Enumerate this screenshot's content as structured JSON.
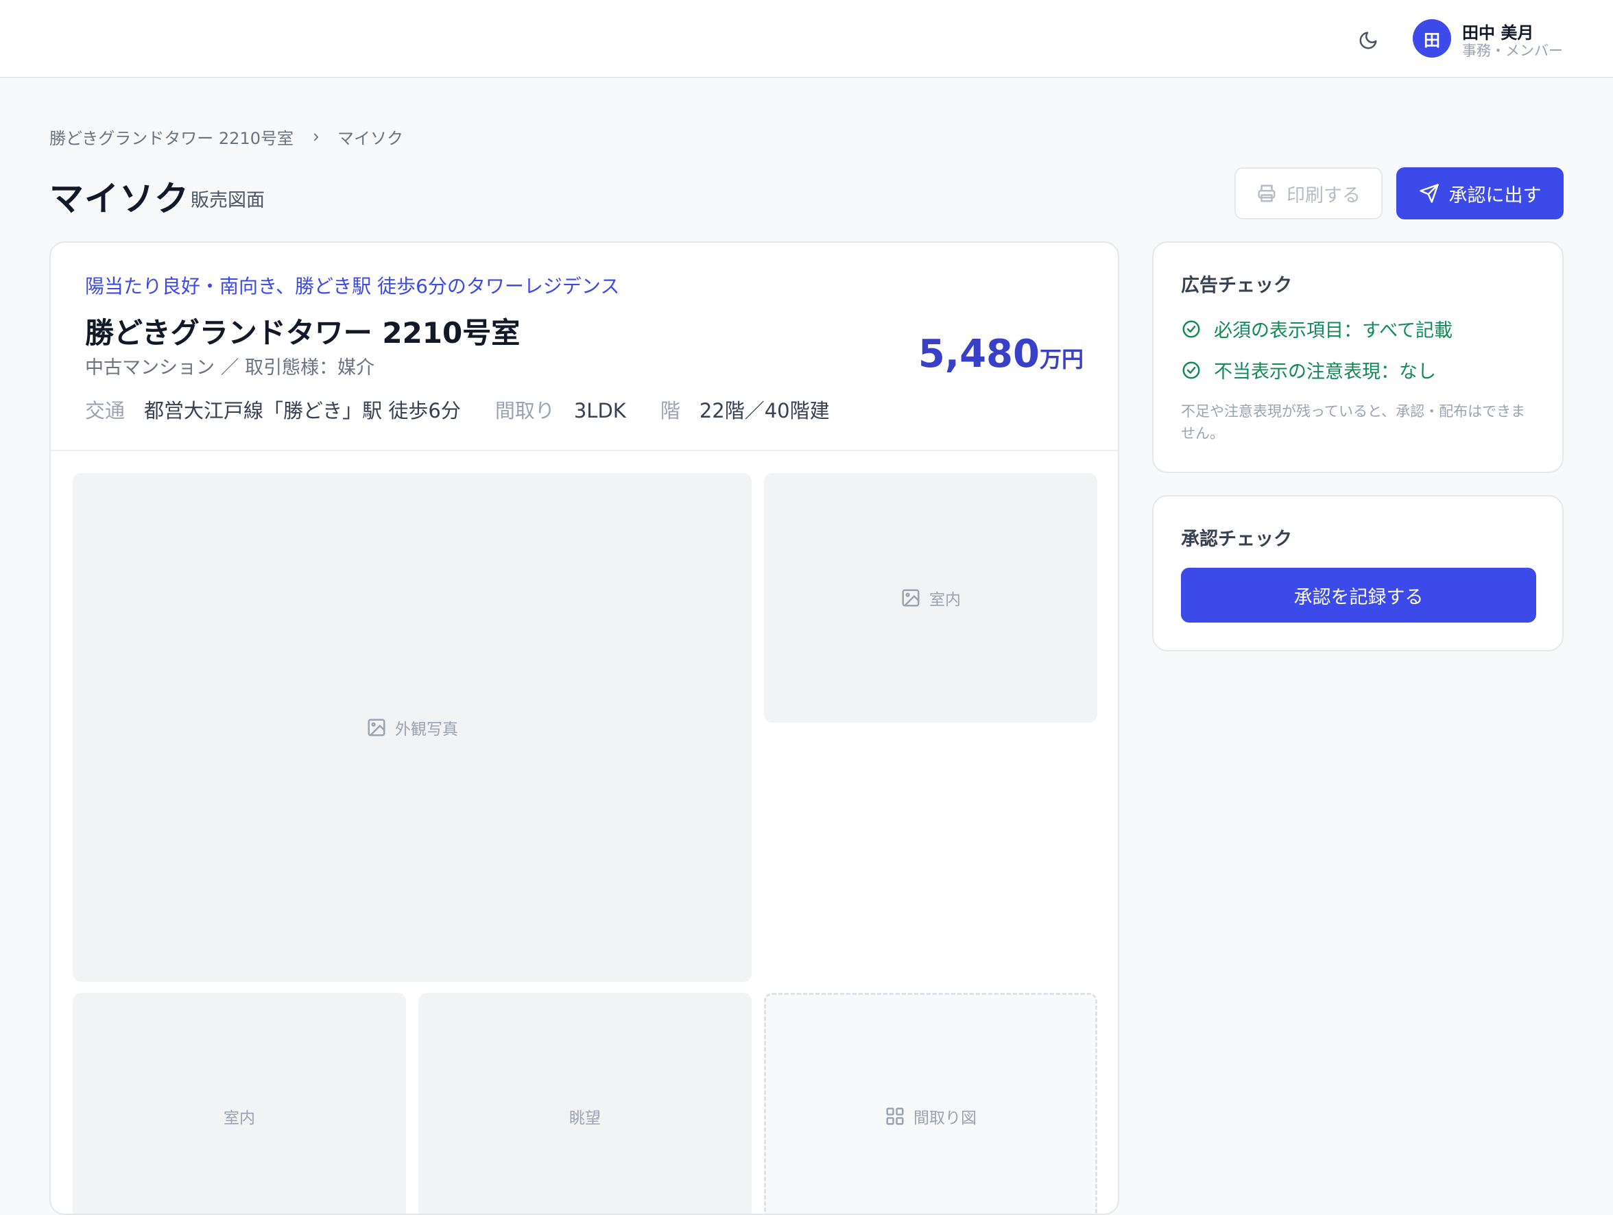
{
  "header": {
    "theme_icon": "moon-icon",
    "user": {
      "initial": "田",
      "name": "田中 美月",
      "role": "事務・メンバー"
    }
  },
  "breadcrumb": {
    "items": [
      "勝どきグランドタワー 2210号室",
      "マイソク"
    ]
  },
  "page": {
    "title": "マイソク",
    "subtitle": "販売図面"
  },
  "actions": {
    "print_label": "印刷する",
    "submit_label": "承認に出す"
  },
  "property": {
    "catchcopy": "陽当たり良好・南向き、勝どき駅 徒歩6分のタワーレジデンス",
    "name": "勝どきグランドタワー 2210号室",
    "type": "中古マンション ／ 取引態様：媒介",
    "price_value": "5,480",
    "price_unit": "万円",
    "specs": [
      {
        "label": "交通",
        "value": "都営大江戸線「勝どき」駅 徒歩6分"
      },
      {
        "label": "間取り",
        "value": "3LDK"
      },
      {
        "label": "階",
        "value": "22階／40階建"
      }
    ]
  },
  "photos": [
    {
      "label": "外観写真",
      "icon": "image-icon"
    },
    {
      "label": "室内",
      "icon": "image-icon"
    },
    {
      "label": "室内",
      "icon": ""
    },
    {
      "label": "眺望",
      "icon": ""
    },
    {
      "label": "間取り図",
      "icon": "grid-icon"
    }
  ],
  "ad_check": {
    "title": "広告チェック",
    "items": [
      "必須の表示項目：すべて記載",
      "不当表示の注意表現：なし"
    ],
    "note": "不足や注意表現が残っていると、承認・配布はできません。"
  },
  "approval_check": {
    "title": "承認チェック",
    "button_label": "承認を記録する"
  },
  "colors": {
    "accent": "#3b4ae8",
    "price": "#3940c8",
    "success": "#118a58"
  }
}
